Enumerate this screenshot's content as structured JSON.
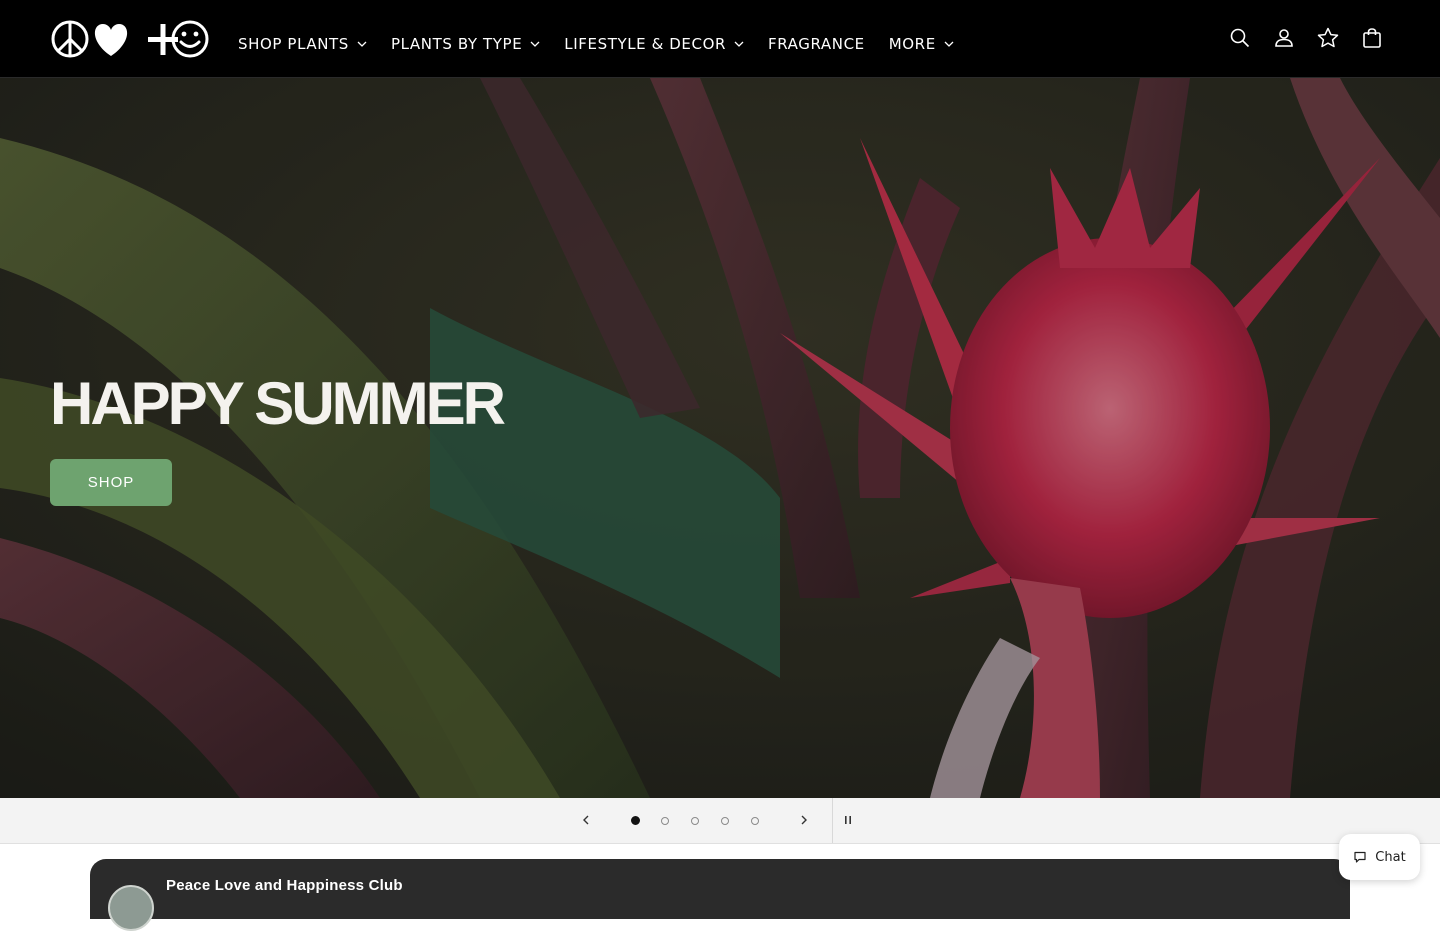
{
  "header": {
    "logo_alt": "Peace Love and Happiness logo",
    "nav": [
      {
        "label": "SHOP PLANTS",
        "has_dropdown": true
      },
      {
        "label": "PLANTS BY TYPE",
        "has_dropdown": true
      },
      {
        "label": "LIFESTYLE & DECOR",
        "has_dropdown": true
      },
      {
        "label": "FRAGRANCE",
        "has_dropdown": false
      },
      {
        "label": "MORE",
        "has_dropdown": true
      }
    ],
    "icons": [
      "search-icon",
      "account-icon",
      "star-icon",
      "cart-icon"
    ]
  },
  "hero": {
    "title": "HAPPY SUMMER",
    "button_label": "SHOP",
    "button_color": "#6ea36f"
  },
  "slider": {
    "slide_count": 5,
    "active_slide": 1,
    "icons": [
      "chevron-left-icon",
      "chevron-right-icon",
      "pause-icon"
    ]
  },
  "club": {
    "title": "Peace Love and Happiness Club"
  },
  "chat": {
    "label": "Chat"
  },
  "colors": {
    "header_bg": "#000000",
    "controls_bg": "#f3f3f3",
    "card_bg": "#2b2b2b"
  }
}
